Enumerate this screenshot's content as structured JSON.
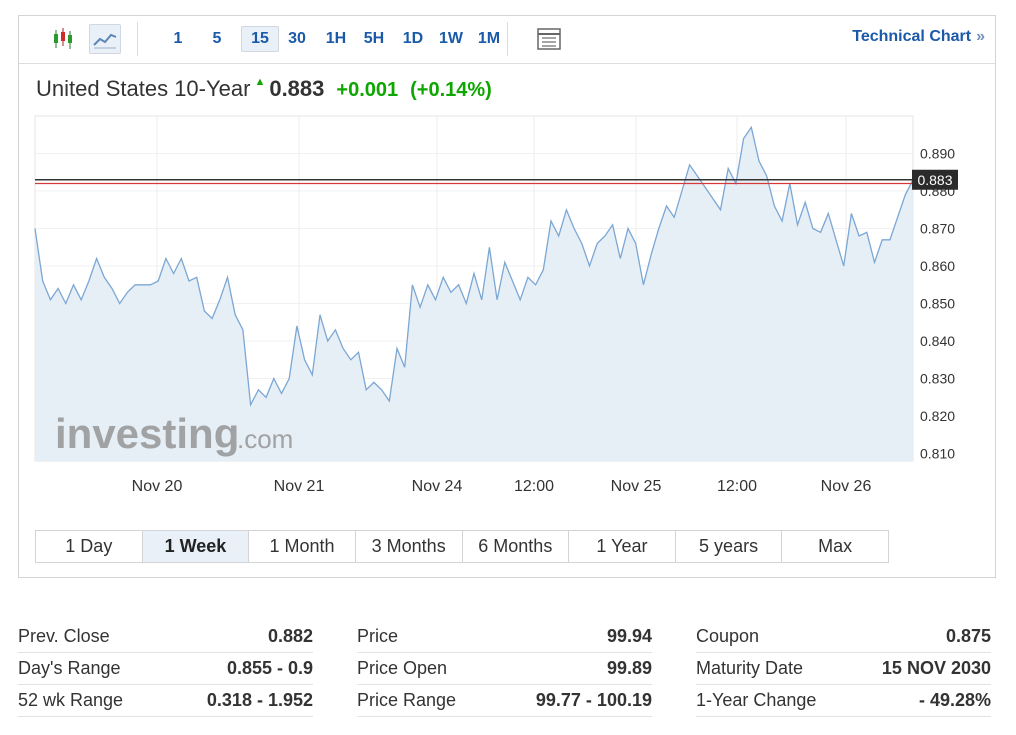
{
  "toolbar": {
    "candle_icon": "candlestick-chart-icon",
    "line_icon": "line-chart-icon",
    "intervals": [
      "1",
      "5",
      "15",
      "30",
      "1H",
      "5H",
      "1D",
      "1W",
      "1M"
    ],
    "active_interval": "15",
    "table_icon": "data-table-icon",
    "technical_chart": "Technical Chart",
    "chevron": "»"
  },
  "quote": {
    "name": "United States 10-Year",
    "price": "0.883",
    "change": "+0.001",
    "change_pct": "(+0.14%)",
    "direction_icon": "up-arrow-icon"
  },
  "chart": {
    "watermark": "investing",
    "watermark_suffix": ".com",
    "current_label": "0.883",
    "colors": {
      "line": "#7ba7d4",
      "fill": "#e6eef6",
      "current": "#333333",
      "prev_close": "#d43a3a",
      "up": "#0ea600",
      "link": "#1a5aa8"
    }
  },
  "chart_data": {
    "type": "area",
    "x_labels": [
      "Nov 20",
      "Nov 21",
      "Nov 24",
      "12:00",
      "Nov 25",
      "12:00",
      "Nov 26"
    ],
    "y_ticks": [
      0.89,
      0.88,
      0.87,
      0.86,
      0.85,
      0.84,
      0.83,
      0.82,
      0.81
    ],
    "ylim": [
      0.808,
      0.9
    ],
    "current_value": 0.883,
    "prev_close_value": 0.882,
    "values": [
      0.87,
      0.856,
      0.851,
      0.854,
      0.85,
      0.855,
      0.851,
      0.856,
      0.862,
      0.857,
      0.854,
      0.85,
      0.853,
      0.855,
      0.855,
      0.855,
      0.856,
      0.862,
      0.858,
      0.862,
      0.856,
      0.857,
      0.848,
      0.846,
      0.851,
      0.857,
      0.847,
      0.843,
      0.823,
      0.827,
      0.825,
      0.83,
      0.826,
      0.83,
      0.844,
      0.835,
      0.831,
      0.847,
      0.84,
      0.843,
      0.838,
      0.835,
      0.837,
      0.827,
      0.829,
      0.827,
      0.824,
      0.838,
      0.833,
      0.855,
      0.849,
      0.855,
      0.851,
      0.857,
      0.853,
      0.855,
      0.85,
      0.858,
      0.851,
      0.865,
      0.851,
      0.861,
      0.856,
      0.851,
      0.857,
      0.855,
      0.859,
      0.872,
      0.868,
      0.875,
      0.87,
      0.866,
      0.86,
      0.866,
      0.868,
      0.871,
      0.862,
      0.87,
      0.866,
      0.855,
      0.863,
      0.87,
      0.876,
      0.873,
      0.88,
      0.887,
      0.884,
      0.881,
      0.878,
      0.875,
      0.886,
      0.882,
      0.894,
      0.897,
      0.888,
      0.884,
      0.876,
      0.872,
      0.882,
      0.871,
      0.877,
      0.87,
      0.869,
      0.874,
      0.867,
      0.86,
      0.874,
      0.868,
      0.869,
      0.861,
      0.867,
      0.867,
      0.873,
      0.879,
      0.883
    ],
    "grid": true
  },
  "ranges": [
    "1 Day",
    "1 Week",
    "1 Month",
    "3 Months",
    "6 Months",
    "1 Year",
    "5 years",
    "Max"
  ],
  "active_range": "1 Week",
  "stats": [
    [
      {
        "label": "Prev. Close",
        "value": "0.882"
      },
      {
        "label": "Day's Range",
        "value": "0.855 - 0.9"
      },
      {
        "label": "52 wk Range",
        "value": "0.318 - 1.952"
      }
    ],
    [
      {
        "label": "Price",
        "value": "99.94"
      },
      {
        "label": "Price Open",
        "value": "99.89"
      },
      {
        "label": "Price Range",
        "value": "99.77 - 100.19"
      }
    ],
    [
      {
        "label": "Coupon",
        "value": "0.875"
      },
      {
        "label": "Maturity Date",
        "value": "15 NOV 2030"
      },
      {
        "label": "1-Year Change",
        "value": "- 49.28%"
      }
    ]
  ]
}
